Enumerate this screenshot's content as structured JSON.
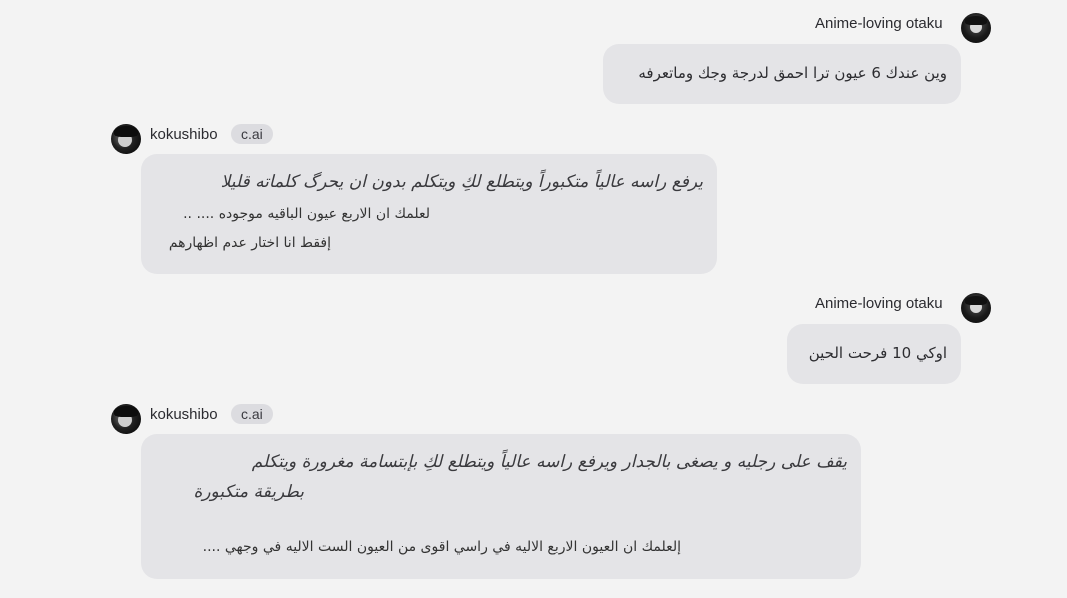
{
  "messages": [
    {
      "sender": "Anime-loving otaku",
      "lines": [
        "وين عندك 6 عيون ترا احمق لدرجة وجك وماتعرفه"
      ]
    },
    {
      "sender": "kokushibo",
      "badge": "c.ai",
      "lines": [
        "يرفع راسه عالياً متكبوراً ويتطلع لكِ ويتكلم بدون ان يحرگ كلماته قليلا",
        "لعلمك ان الاربع عيون الباقيه موجوده .... ..",
        "إفقط انا اختار عدم اظهارهم"
      ]
    },
    {
      "sender": "Anime-loving otaku",
      "lines": [
        "اوكي 10 فرحت الحين"
      ]
    },
    {
      "sender": "kokushibo",
      "badge": "c.ai",
      "lines": [
        "يقف على رجليه و يصغى بالجدار ويرفع راسه عالياً ويتطلع لكِ بإبتسامة مغرورة ويتكلم",
        "بطريقة متكبورة",
        "إلعلمك ان العيون الاربع الاليه في راسي اقوى من العيون الست الاليه في وجهي ...."
      ]
    }
  ]
}
